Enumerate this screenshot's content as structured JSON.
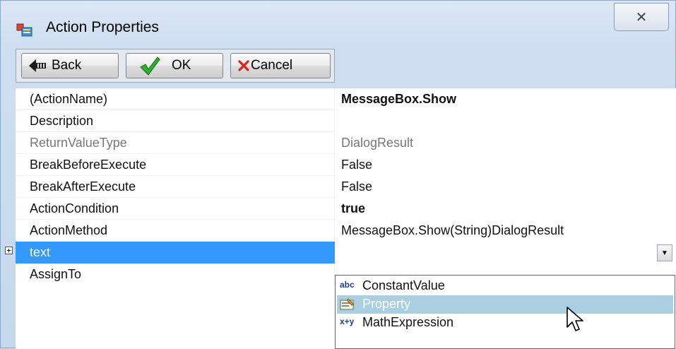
{
  "window": {
    "title": "Action Properties",
    "close_glyph": "✕",
    "icon": "properties-window-icon"
  },
  "toolbar": {
    "back": {
      "label": "Back",
      "icon": "back-arrow-icon"
    },
    "ok": {
      "label": "OK",
      "icon": "checkmark-icon"
    },
    "cancel": {
      "label": "Cancel",
      "icon": "red-x-icon"
    }
  },
  "properties": [
    {
      "name": "(ActionName)",
      "value": "MessageBox.Show",
      "bold": true
    },
    {
      "name": "Description",
      "value": ""
    },
    {
      "name": "ReturnValueType",
      "value": "DialogResult",
      "disabled": true
    },
    {
      "name": "BreakBeforeExecute",
      "value": "False"
    },
    {
      "name": "BreakAfterExecute",
      "value": "False"
    },
    {
      "name": "ActionCondition",
      "value": "true",
      "bold": true
    },
    {
      "name": "ActionMethod",
      "value": "MessageBox.Show(String)DialogResult"
    },
    {
      "name": "text",
      "value": "",
      "selected": true,
      "expandable": true,
      "expander_glyph": "+"
    },
    {
      "name": "AssignTo",
      "value": ""
    }
  ],
  "dropdown": {
    "button_glyph": "▼",
    "options": [
      {
        "label": "ConstantValue",
        "icon_text": "abc",
        "icon": "abc-constant-icon"
      },
      {
        "label": "Property",
        "icon": "property-icon",
        "hovered": true
      },
      {
        "label": "MathExpression",
        "icon_text": "x+y",
        "icon": "math-expression-icon"
      }
    ]
  },
  "colors": {
    "selection": "#3399ff",
    "hover": "#a9cfe0",
    "window_bg": "#cfdff1"
  }
}
